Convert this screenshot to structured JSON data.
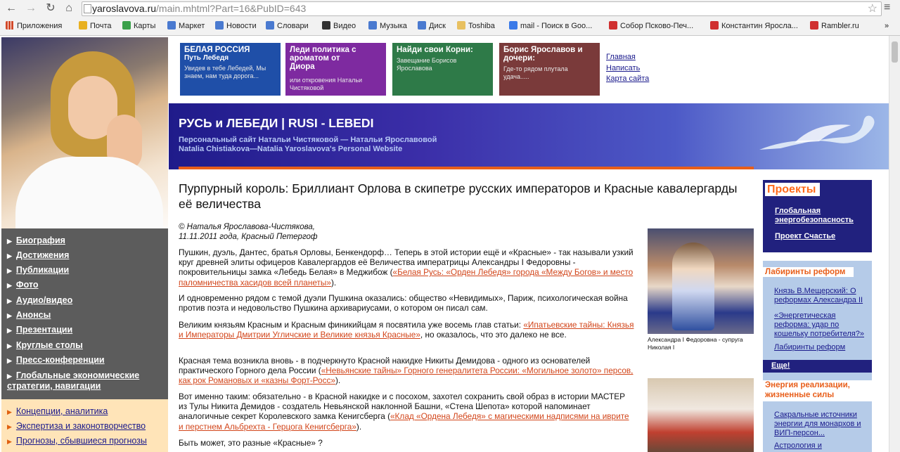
{
  "browser": {
    "url_host": "yaroslavova.ru",
    "url_path": "/main.mhtml?Part=16&PubID=643",
    "bookmarks": [
      {
        "label": "Приложения",
        "color": "#d24a2a"
      },
      {
        "label": "Почта",
        "color": "#e8b020"
      },
      {
        "label": "Карты",
        "color": "#3aa04a"
      },
      {
        "label": "Маркет",
        "color": "#4a7ad0"
      },
      {
        "label": "Новости",
        "color": "#4a7ad0"
      },
      {
        "label": "Словари",
        "color": "#4a7ad0"
      },
      {
        "label": "Видео",
        "color": "#333333"
      },
      {
        "label": "Музыка",
        "color": "#4a7ad0"
      },
      {
        "label": "Диск",
        "color": "#4a7ad0"
      },
      {
        "label": "Toshiba",
        "color": "#e8c060"
      },
      {
        "label": "mail - Поиск в Goo...",
        "color": "#3a7ae8"
      },
      {
        "label": "Собор Псково-Печ...",
        "color": "#d03030"
      },
      {
        "label": "Константин Яросла...",
        "color": "#d03030"
      },
      {
        "label": "Rambler.ru",
        "color": "#d03030"
      }
    ],
    "more": "»"
  },
  "banners": [
    {
      "title": "БЕЛАЯ РОССИЯ",
      "subtitle": "Путь Лебедя",
      "text": "Увидев в тебе Лебедей, Мы знаем, нам туда дорога...",
      "color": "#1f4fa8"
    },
    {
      "title": "Леди политика с ароматом от Диора",
      "text": "или откровения Натальи Чистяковой",
      "color": "#7e2aa0"
    },
    {
      "title": "Найди свои Корни:",
      "text": "Завещание Борисов Ярославова",
      "color": "#2e7a48"
    },
    {
      "title": "Борис Ярославов и дочери:",
      "text": "Где-то рядом плутала удача.....",
      "color": "#7a3a3a"
    }
  ],
  "top_links": [
    "Главная",
    "Написать",
    "Карта сайта"
  ],
  "header": {
    "title": "РУСЬ и ЛЕБЕДИ | RUSI - LEBEDI",
    "subtitle_ru": "Персональный сайт Натальи Чистяковой — Натальи Ярославовой",
    "subtitle_en": "Natalia Chistiakova—Natalia Yaroslavova's Personal Website"
  },
  "left_nav": [
    "Биография",
    "Достижения",
    "Публикации",
    "Фото",
    "Аудио/видео",
    "Анонсы",
    "Презентации",
    "Круглые столы",
    "Пресс-конференции",
    "Глобальные экономические стратегии, навигации"
  ],
  "left_nav2": [
    "Концепции, аналитика",
    "Экспертиза и законотворчество",
    "Прогнозы, сбывшиеся прогнозы"
  ],
  "article": {
    "title": "Пурпурный король: Бриллиант Орлова в скипетре русских императоров и Красные кавалергарды её величества",
    "byline1": "© Наталья Ярославова-Чистякова,",
    "byline2": "11.11.2011 года, Красный Петергоф",
    "p1_text": "Пушкин, дуэль, Дантес, братья Орловы, Бенкендорф… Теперь в этой истории ещё и «Красные» - так называли узкий круг древней элиты офицеров Кавалергардов её Величества императрицы Александры I Федоровны - покровительницы замка «Лебедь Белая» в Меджибож (",
    "p1_link": "«Белая Русь: «Орден Лебедя» города «Между Богов» и место паломничества хасидов всей планеты»",
    "p1_end": ").",
    "p2_text": "И одновременно рядом с темой дуэли Пушкина оказались: общество «Невидимых», Париж, психологическая война против поэта и недовольство Пушкина архивариусами, о котором он писал сам.",
    "p3_text": "Великим князьям Красным и Красным финикийцам я посвятила уже восемь глав статьи: ",
    "p3_link": "«Ипатьевские тайны: Князья и Императоры Дмитрии Угличские и Великие князья Красные»",
    "p3_end": ", но оказалось, что это далеко не все.",
    "p4_text": "Красная тема возникла вновь - в подчеркнуто Красной накидке Никиты Демидова - одного из основателей практического Горного дела России (",
    "p4_link": "«Невьянские тайны» Горного генералитета России: «Могильное золото» персов, как рок Романовых и «казны Форт-Росс»",
    "p4_end": ").",
    "p5_text": "Вот именно таким: обязательно - в Красной накидке и с посохом, захотел сохранить свой образ в истории МАСТЕР из Тулы Никита Демидов - создатель Невьянской наклонной Башни, «Стена Шепота» которой напоминает аналогичные секрет Королевского замка Кенигсберга (",
    "p5_link": "«Клад «Ордена Лебедя» с магическими надписями на иврите и перстнем Альбрехта - Герцога Кенигсберга»",
    "p5_end": ").",
    "p6_text": "Быть может, это разные «Красные» ?",
    "img1_caption": "Александра I Федоровна - супруга Николая I"
  },
  "sidebar": {
    "projects_title": "Проекты",
    "projects": [
      "Глобальная энергобезопасность",
      "Проект Счастье"
    ],
    "reforms_title": "Лабиринты реформ",
    "reforms": [
      "Князь В.Мещерский: О реформах Александра II",
      "«Энергетическая реформа: удар по кошельку потребителя?»",
      "Лабиринты реформ"
    ],
    "more": "Еще!",
    "energy_title": "Энергия реализации, жизненные силы",
    "energy": [
      "Сакральные источники энергии для монархов и ВИП-персон...",
      "Астрология и"
    ]
  }
}
